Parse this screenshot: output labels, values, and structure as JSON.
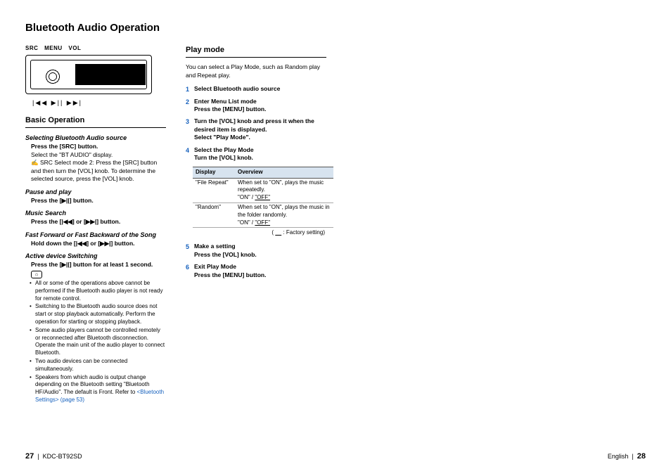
{
  "title": "Bluetooth Audio Operation",
  "diagram": {
    "labels": [
      "SRC",
      "MENU",
      "VOL"
    ],
    "transport": "|◀◀   ▶||   ▶▶|"
  },
  "basic": {
    "heading": "Basic Operation",
    "items": [
      {
        "title": "Selecting Bluetooth Audio source",
        "bold": "Press the [SRC] button.",
        "body": "Select the \"BT AUDIO\" display.",
        "note": "✍ SRC Select mode 2: Press the [SRC] button and then turn the [VOL] knob. To determine the selected source, press the [VOL] knob."
      },
      {
        "title": "Pause and play",
        "bold": "Press the [▶||] button."
      },
      {
        "title": "Music Search",
        "bold": "Press the [|◀◀] or [▶▶|] button."
      },
      {
        "title": "Fast Forward or Fast Backward of the Song",
        "bold": "Hold down the [|◀◀] or [▶▶|] button."
      },
      {
        "title": "Active device Switching",
        "bold": "Press the [▶||] button for at least 1 second."
      }
    ],
    "notes": [
      "All or some of the operations above cannot be performed if the Bluetooth audio player is not ready for remote control.",
      "Switching to the Bluetooth audio source does not start or stop playback automatically. Perform the operation for starting or stopping playback.",
      "Some audio players cannot be controlled remotely or reconnected after Bluetooth disconnection. Operate the main unit of the audio player to connect Bluetooth.",
      "Two audio devices can be connected simultaneously.",
      "Speakers from which audio is output change depending on the Bluetooth setting \"Bluetooth HF/Audio\". The default is Front. Refer to "
    ],
    "link": "<Bluetooth Settings> (page 53)"
  },
  "playmode": {
    "heading": "Play mode",
    "intro": "You can select a Play Mode, such as Random play and Repeat play.",
    "steps": [
      {
        "n": "1",
        "title": "Select Bluetooth audio source"
      },
      {
        "n": "2",
        "title": "Enter Menu List mode",
        "body": "Press the [MENU] button."
      },
      {
        "n": "3",
        "title": "Turn the [VOL] knob and press it when the desired item is displayed.",
        "body": "Select \"Play Mode\"."
      },
      {
        "n": "4",
        "title": "Select the Play Mode",
        "body": "Turn the [VOL] knob."
      },
      {
        "n": "5",
        "title": "Make a setting",
        "body": "Press the [VOL] knob."
      },
      {
        "n": "6",
        "title": "Exit Play Mode",
        "body": "Press the [MENU] button."
      }
    ],
    "table": {
      "headers": [
        "Display",
        "Overview"
      ],
      "rows": [
        {
          "display": "\"File Repeat\"",
          "overview": "When set to \"ON\", plays the music repeatedly.",
          "opts": "\"ON\" / \"OFF\""
        },
        {
          "display": "\"Random\"",
          "overview": "When set to \"ON\", plays the music in the folder randomly.",
          "opts": "\"ON\" / \"OFF\""
        }
      ],
      "factory_label": ": Factory setting)"
    }
  },
  "footer": {
    "left_page": "27",
    "left_sep": "|",
    "model": "KDC-BT92SD",
    "right_lang": "English",
    "right_sep": "|",
    "right_page": "28"
  }
}
